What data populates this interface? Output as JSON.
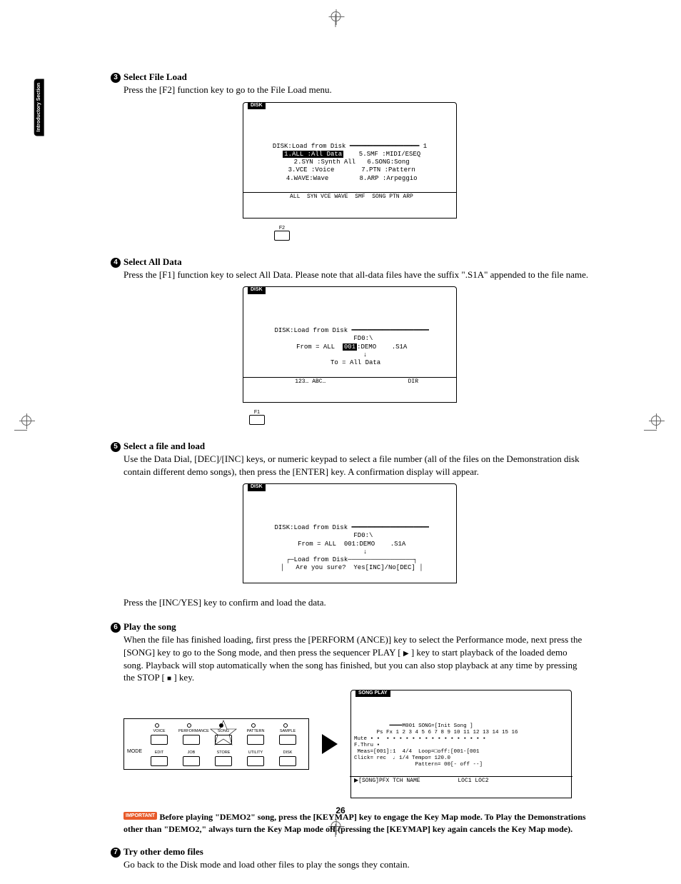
{
  "sideTab": "Introductory\nSection",
  "pageNumber": "26",
  "steps": {
    "s3": {
      "num": "3",
      "title": "Select File Load",
      "body": "Press the [F2] function key to go to the File Load menu.",
      "lcd": {
        "tab": "DISK",
        "line1a": "DISK:Load from Disk",
        "line1b": "1",
        "row1a": "1.ALL :All Data",
        "row1b": "5.SMF :MIDI/ESEQ",
        "row2a": "2.SYN :Synth All",
        "row2b": "6.SONG:Song",
        "row3a": "3.VCE :Voice",
        "row3b": "7.PTN :Pattern",
        "row4a": "4.WAVE:Wave",
        "row4b": "8.ARP :Arpeggio",
        "footer": " ALL  SYN VCE WAVE  SMF  SONG PTN ARP",
        "fkey": "F2"
      }
    },
    "s4": {
      "num": "4",
      "title": "Select All Data",
      "body": "Press the [F1] function key to select All Data. Please note that all-data files have the suffix \".S1A\" appended to the file name.",
      "lcd": {
        "tab": "DISK",
        "line1": " DISK:Load from Disk",
        "line2": "       FD0:\\",
        "line3a": " From = ALL  ",
        "line3b": "001",
        "line3c": ":DEMO    .S1A",
        "line4": "        ↓",
        "line5": "   To = All Data",
        "footer": "    123… ABC…                        DIR",
        "fkey": "F1"
      }
    },
    "s5": {
      "num": "5",
      "title": "Select a file and load",
      "body": "Use the Data Dial, [DEC]/[INC] keys, or numeric keypad to select a file number (all of the files on the Demonstration disk contain different demo songs), then press the [ENTER] key. A confirmation display will appear.",
      "lcd": {
        "tab": "DISK",
        "line1": " DISK:Load from Disk",
        "line2": "       FD0:\\",
        "line3": " From = ALL  001:DEMO    .S1A",
        "line4": "        ↓",
        "line5": " ┌─Load from Disk─────────────────┐",
        "line6": " │   Are you sure?  Yes[INC]/No[DEC] │"
      },
      "followup": "Press the [INC/YES] key to confirm and load the data."
    },
    "s6": {
      "num": "6",
      "title": "Play the song",
      "bodyA": "When the file has finished loading, first press the [PERFORM (ANCE)] key to select the Performance mode, next press the [SONG] key to go to the Song mode, and then press the sequencer PLAY [ ",
      "bodyB": " ] key to start playback of the loaded demo song. Playback will stop automatically when the song has finished, but you can also stop playback at any time by pressing the STOP [ ",
      "bodyC": " ] key.",
      "panel": {
        "modeLabel": "MODE",
        "top": [
          "VOICE",
          "PERFORMANCE",
          "SONG",
          "PATTERN",
          "SAMPLE"
        ],
        "bottom": [
          "EDIT",
          "JOB",
          "STORE",
          "UTILITY",
          "DISK"
        ]
      },
      "songLcd": {
        "tab": "SONG PLAY",
        "l1": "           ━━━━M001 SONG=[Init Song ]",
        "l2": "       Ps Fx 1 2 3 4 5 6 7 8 9 10 11 12 13 14 15 16",
        "l3": "Mute ▪ ▪  ▪ ▪ ▪ ▪ ▪ ▪ ▪ ▪ ▪ ▪ ▪ ▪ ▪ ▪ ▪ ▪",
        "l4": "F.Thru ▪",
        "l5": " Meas=[001]:1  4/4  Loop=□off:[001-[001",
        "l6": "Click= rec  ♩ 1/4 Tempo= 120.0",
        "l7": "                   Pattern= 00[- off --]",
        "footer": "▶[SONG]PFX TCH NAME           LOC1 LOC2"
      }
    },
    "note": {
      "tag": "IMPORTANT",
      "text": "Before playing \"DEMO2\" song, press the [KEYMAP] key to engage the Key Map mode. To Play the Demonstrations other than \"DEMO2,\" always turn the Key Map mode off (pressing the [KEYMAP] key again cancels the Key Map mode)."
    },
    "s7": {
      "num": "7",
      "title": "Try other demo files",
      "body": "Go back to the Disk mode and load other files to play the songs they contain."
    }
  }
}
